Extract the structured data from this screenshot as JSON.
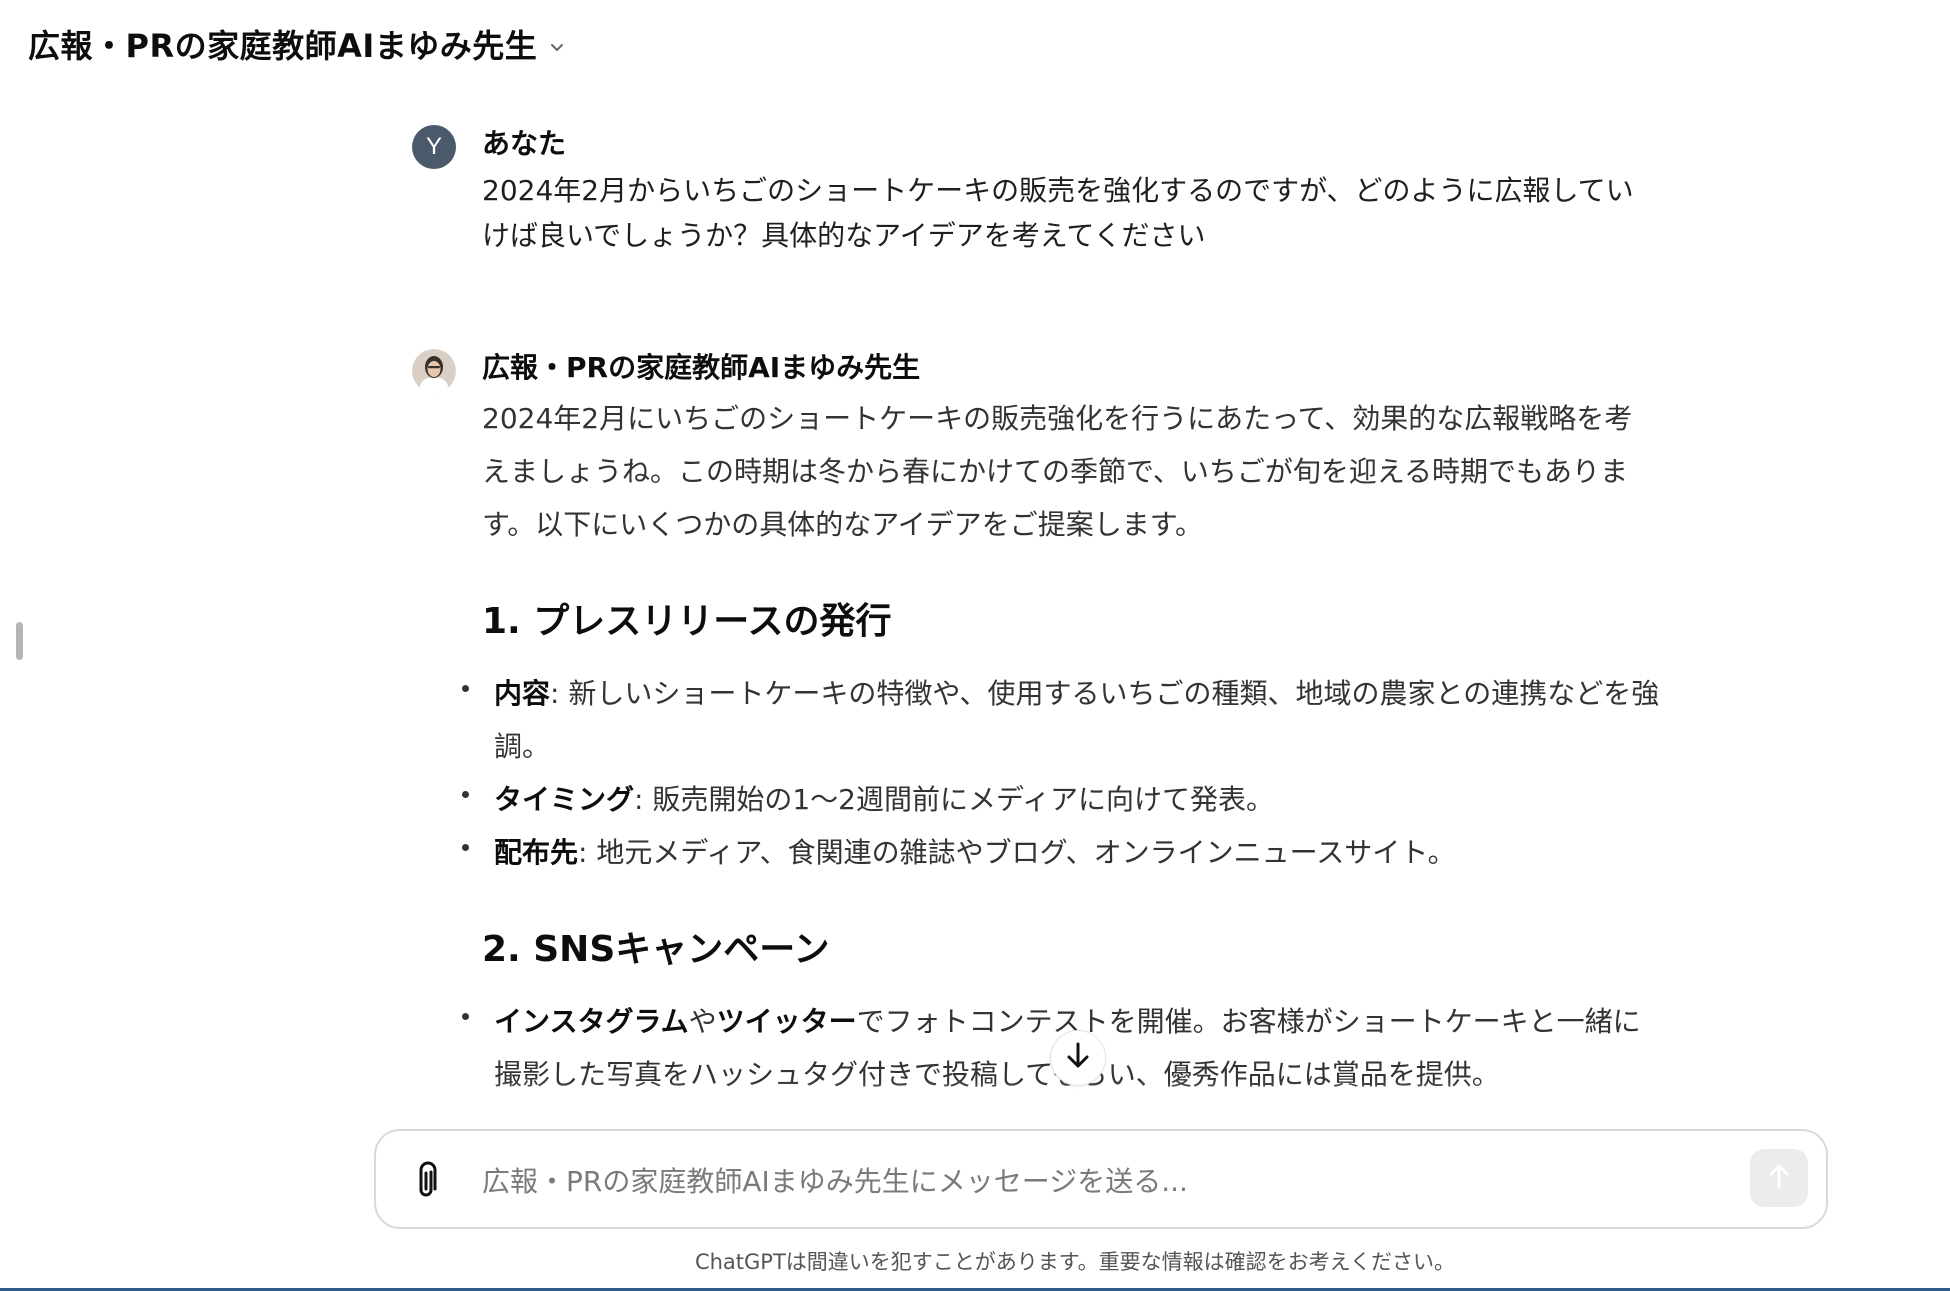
{
  "header": {
    "title": "広報・PRの家庭教師AIまゆみ先生",
    "chevron_icon": "chevron-down-icon"
  },
  "conversation": {
    "user": {
      "avatar_letter": "Y",
      "author": "あなた",
      "text": "2024年2月からいちごのショートケーキの販売を強化するのですが、どのように広報していけば良いでしょうか？具体的なアイデアを考えてください"
    },
    "assistant": {
      "author": "広報・PRの家庭教師AIまゆみ先生",
      "intro": "2024年2月にいちごのショートケーキの販売強化を行うにあたって、効果的な広報戦略を考えましょうね。この時期は冬から春にかけての季節で、いちごが旬を迎える時期でもあります。以下にいくつかの具体的なアイデアをご提案します。",
      "section1": {
        "heading": "1. プレスリリースの発行",
        "items": [
          {
            "label": "内容",
            "text": ": 新しいショートケーキの特徴や、使用するいちごの種類、地域の農家との連携などを強調。"
          },
          {
            "label": "タイミング",
            "text": ": 販売開始の1〜2週間前にメディアに向けて発表。"
          },
          {
            "label": "配布先",
            "text": ": 地元メディア、食関連の雑誌やブログ、オンラインニュースサイト。"
          }
        ]
      },
      "section2": {
        "heading": "2. SNSキャンペーン",
        "item": {
          "bold1": "インスタグラム",
          "mid": "や",
          "bold2": "ツイッター",
          "text": "でフォトコンテストを開催。お客様がショートケーキと一緒に撮影した写真をハッシュタグ付きで投稿してもらい、優秀作品には賞品を提供。"
        }
      }
    }
  },
  "composer": {
    "placeholder": "広報・PRの家庭教師AIまゆみ先生にメッセージを送る...",
    "attach_icon": "paperclip-icon",
    "send_icon": "arrow-up-icon"
  },
  "scroll_button_icon": "arrow-down-icon",
  "disclaimer": "ChatGPTは間違いを犯すことがあります。重要な情報は確認をお考えください。",
  "colors": {
    "user_avatar_bg": "#4b5a6a",
    "accent_line": "#2f5b8a"
  }
}
